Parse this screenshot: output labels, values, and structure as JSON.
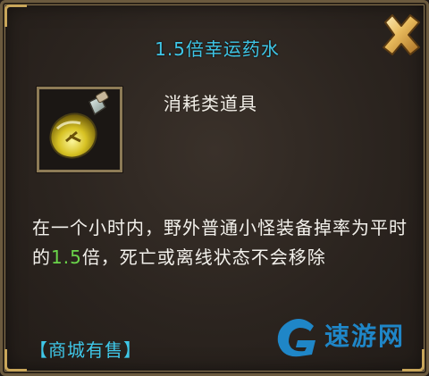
{
  "dialog": {
    "title": "1.5倍幸运药水",
    "close_icon": "close-x-icon"
  },
  "item": {
    "icon": "potion-flask-icon",
    "category": "消耗类道具",
    "description_parts": [
      "在一个小时内，野外普通小怪装备掉率为平时的",
      "1.5",
      "倍，死亡或离线状态不会移除"
    ],
    "highlight_color": "#6ad44a"
  },
  "shop": {
    "label": "【商城有售】"
  },
  "watermark": {
    "icon": "g-logo-icon",
    "text": "速游网"
  },
  "colors": {
    "title": "#3fc7e8",
    "text": "#f3f1ec",
    "frame": "#8d7b56"
  }
}
